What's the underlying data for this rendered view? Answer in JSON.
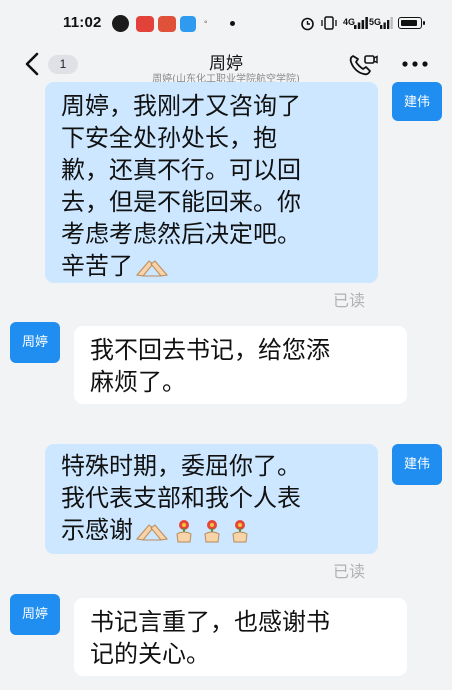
{
  "status_bar": {
    "time": "11:02",
    "network_label": "4G",
    "network2_label": "5G",
    "battery_level": 0.9
  },
  "header": {
    "unread_count": "1",
    "title": "周婷",
    "subtitle": "周婷(山东化工职业学院航空学院)"
  },
  "messages": [
    {
      "side": "out",
      "sender": "建伟",
      "lines": [
        "周婷，我刚才又咨询了",
        "下安全处孙处长，抱",
        "歉，还真不行。可以回",
        "去，但是不能回来。你",
        "考虑考虑然后决定吧。",
        "辛苦了"
      ],
      "read_status": "已读"
    },
    {
      "side": "in",
      "sender": "周婷",
      "lines": [
        "我不回去书记，给您添",
        "麻烦了。"
      ]
    },
    {
      "side": "out",
      "sender": "建伟",
      "lines": [
        "特殊时期，委屈你了。",
        "我代表支部和我个人表",
        "示感谢"
      ],
      "read_status": "已读"
    },
    {
      "side": "in",
      "sender": "周婷",
      "lines": [
        "书记言重了，也感谢书",
        "记的关心。"
      ]
    }
  ],
  "colors": {
    "outgoing_bubble": "#cce7ff",
    "incoming_bubble": "#ffffff",
    "avatar": "#1f8ef0",
    "background": "#f2f3f5"
  },
  "icons": [
    "back-arrow-icon",
    "phone-call-icon",
    "more-icon",
    "thank-you-hands-icon",
    "flower-hand-icon"
  ]
}
